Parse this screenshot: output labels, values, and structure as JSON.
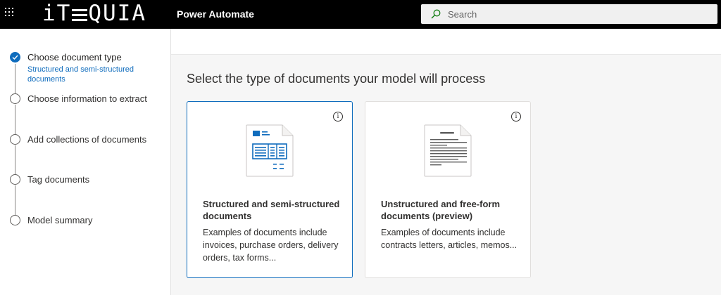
{
  "header": {
    "logo_text": "iTEQUIA",
    "logo_prefix": "iT",
    "logo_suffix": "QUIA",
    "app_title": "Power Automate",
    "search_placeholder": "Search"
  },
  "steps": [
    {
      "label": "Choose document type",
      "sublabel": "Structured and semi-structured documents",
      "status": "done"
    },
    {
      "label": "Choose information to extract",
      "status": "pending"
    },
    {
      "label": "Add collections of documents",
      "status": "pending"
    },
    {
      "label": "Tag documents",
      "status": "pending"
    },
    {
      "label": "Model summary",
      "status": "pending"
    }
  ],
  "main": {
    "title": "Select the type of documents your model will process",
    "cards": [
      {
        "title": "Structured and semi-structured documents",
        "description": "Examples of documents include invoices, purchase orders, delivery orders, tax forms...",
        "selected": true,
        "icon": "structured-document-icon"
      },
      {
        "title": "Unstructured and free-form documents (preview)",
        "description": "Examples of documents include contracts letters, articles, memos...",
        "selected": false,
        "icon": "unstructured-document-icon"
      }
    ]
  },
  "colors": {
    "accent": "#0f6cbd",
    "header_bg": "#000000"
  }
}
